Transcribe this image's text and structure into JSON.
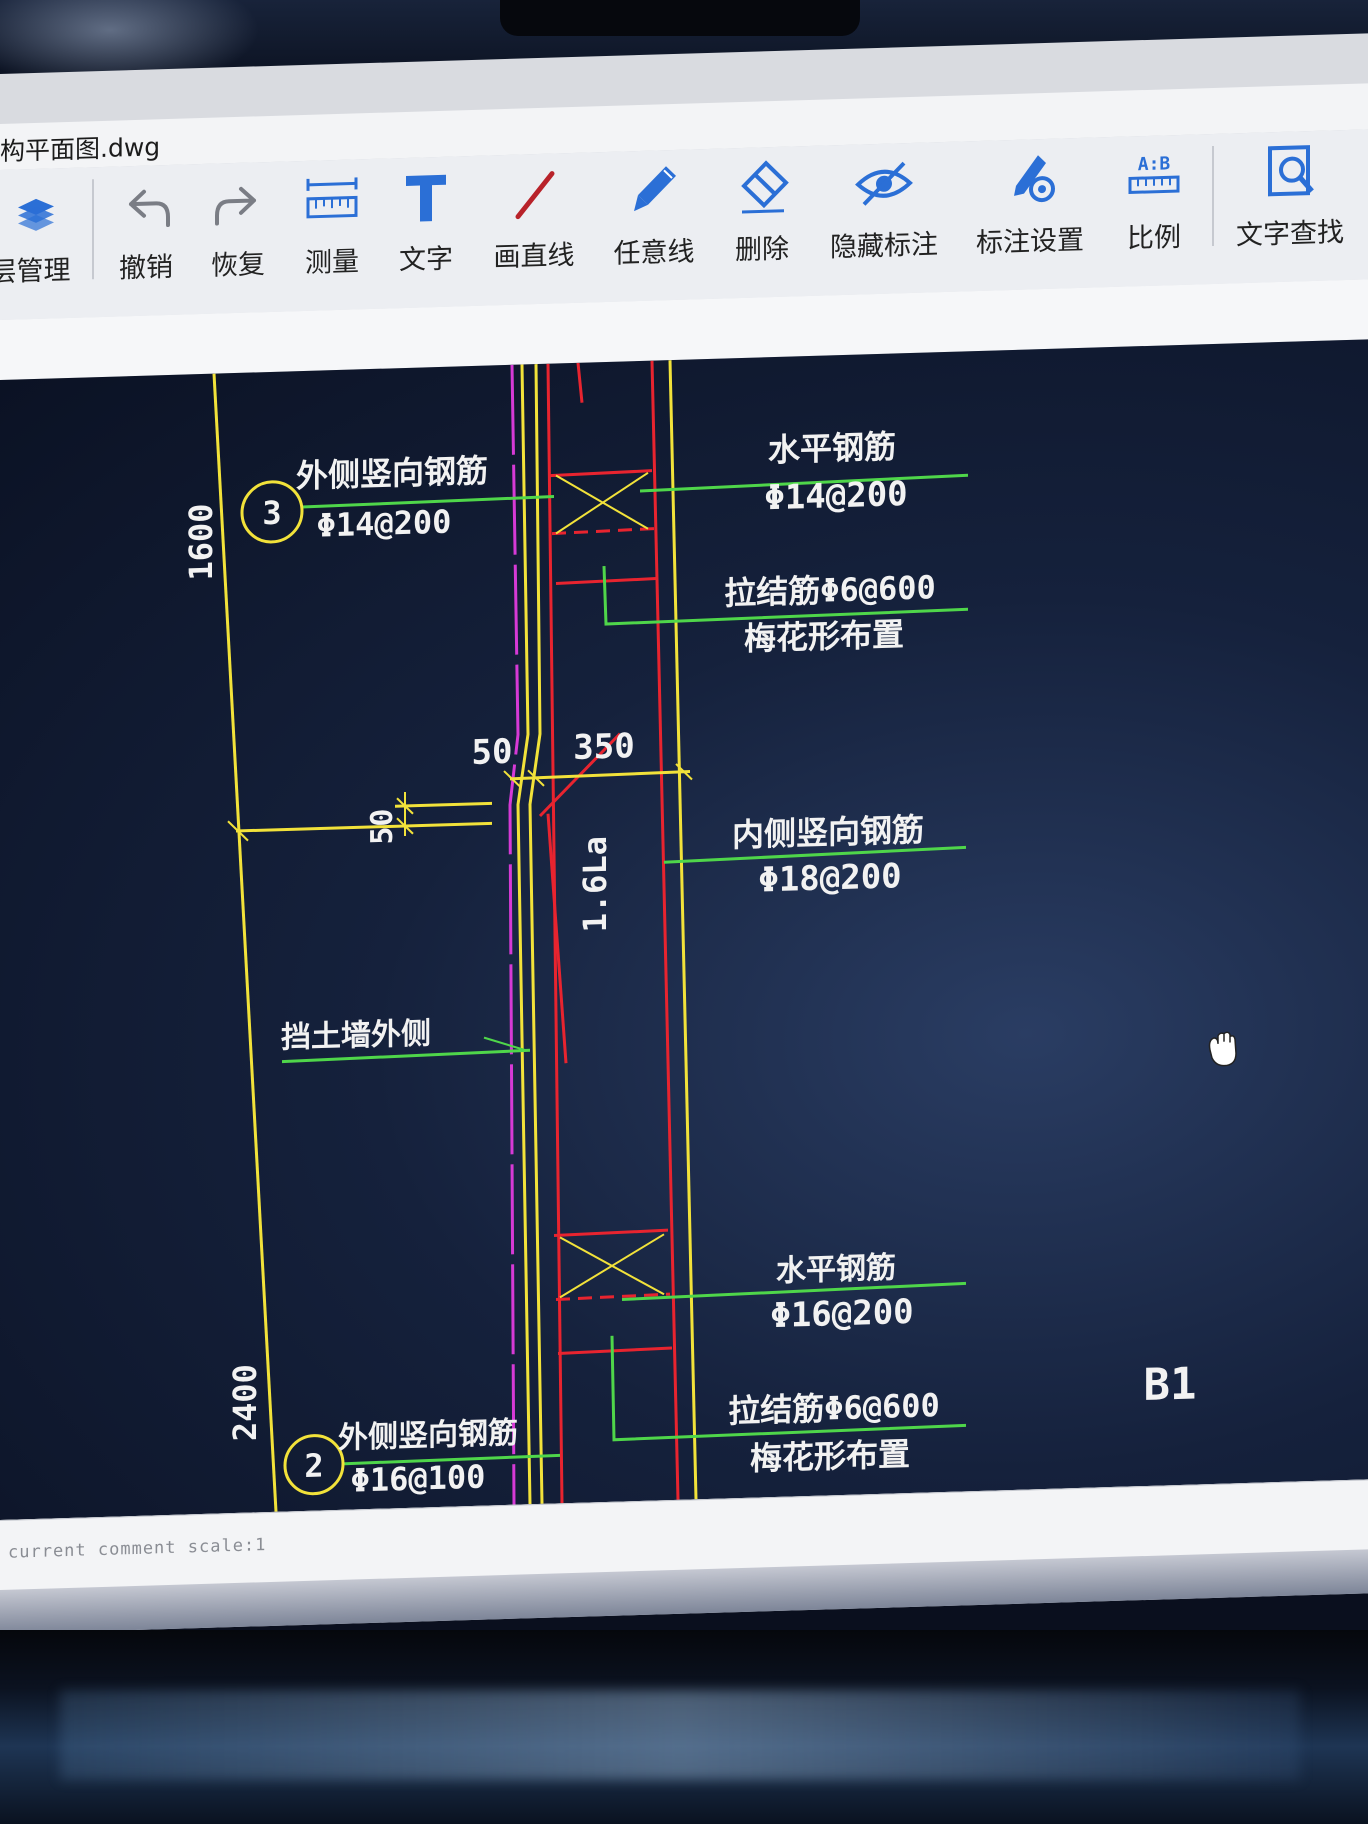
{
  "window": {
    "title": "构平面图.dwg"
  },
  "toolbar": {
    "items": [
      {
        "label": "层管理",
        "icon": "layers-icon"
      },
      {
        "label": "撤销",
        "icon": "undo-icon"
      },
      {
        "label": "恢复",
        "icon": "redo-icon"
      },
      {
        "label": "测量",
        "icon": "measure-icon"
      },
      {
        "label": "文字",
        "icon": "text-icon"
      },
      {
        "label": "画直线",
        "icon": "line-icon"
      },
      {
        "label": "任意线",
        "icon": "freehand-pen-icon"
      },
      {
        "label": "删除",
        "icon": "eraser-icon"
      },
      {
        "label": "隐藏标注",
        "icon": "hide-eye-icon"
      },
      {
        "label": "标注设置",
        "icon": "annotation-settings-icon"
      },
      {
        "label": "比例",
        "icon": "scale-ratio-icon"
      },
      {
        "label": "文字查找",
        "icon": "text-search-icon"
      }
    ],
    "scale_icon_text": "A:B"
  },
  "drawing": {
    "dim_1600": "1600",
    "dim_2400": "2400",
    "dim_50_top": "50",
    "dim_350": "350",
    "dim_50_side": "50",
    "dim_16la": "1.6La",
    "marker_3": "3",
    "marker_2": "2",
    "outer_vertical_rebar_label": "外侧竖向钢筋",
    "outer_vertical_rebar_top_spec": "Φ14@200",
    "outer_vertical_rebar_bottom_spec": "Φ16@100",
    "horizontal_rebar_label": "水平钢筋",
    "horizontal_rebar_top_spec": "Φ14@200",
    "horizontal_rebar_bottom_spec": "Φ16@200",
    "tie_bar_spec": "拉结筋Φ6@600",
    "tie_bar_layout": "梅花形布置",
    "inner_vertical_rebar_label": "内侧竖向钢筋",
    "inner_vertical_rebar_spec": "Φ18@200",
    "retaining_wall_outer_label": "挡土墙外侧",
    "level_label": "B1"
  },
  "status": {
    "text": "current comment scale:1"
  },
  "colors": {
    "toolbar_icon": "#2b6fd6",
    "cad_yellow": "#f2e23a",
    "cad_red": "#e8242f",
    "cad_green": "#4fd64a",
    "cad_magenta": "#d63ad6",
    "canvas_bg": "#15213c"
  }
}
